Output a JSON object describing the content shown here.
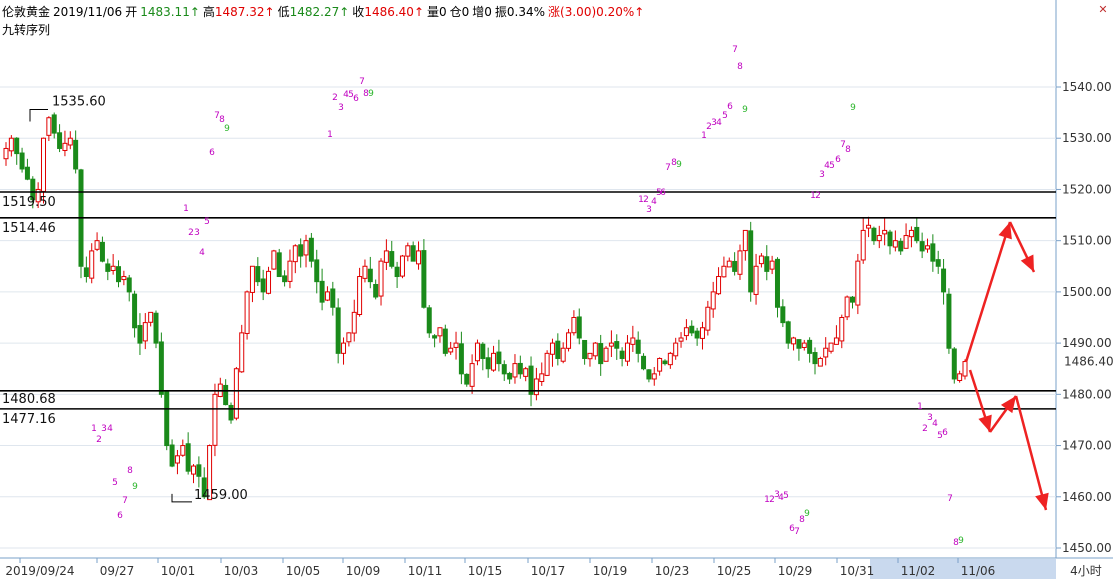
{
  "header": {
    "symbol": "伦敦黄金",
    "date": "2019/11/06",
    "open_label": "开",
    "open": "1483.11",
    "high_label": "高",
    "high": "1487.32",
    "low_label": "低",
    "low": "1482.27",
    "close_label": "收",
    "close": "1486.40",
    "volume": "量0",
    "position": "仓0",
    "increase": "增0",
    "amplitude": "振0.34%",
    "change": "涨(3.00)0.20%",
    "arrow": "↑"
  },
  "indicator_label": "九转序列",
  "period_label": "4小时",
  "colors": {
    "up": "#e00000",
    "down": "#1a8a1a",
    "td_buy": "#c000c0",
    "td_sell": "#2bb52b",
    "axis": "#7aa0c8"
  },
  "chart_data": {
    "type": "candlestick",
    "ylim": [
      1448,
      1552
    ],
    "yticks": [
      "1540.00",
      "1530.00",
      "1520.00",
      "1510.00",
      "1500.00",
      "1490.00",
      "1480.00",
      "1470.00",
      "1460.00",
      "1450.00"
    ],
    "xticks": [
      "2019/09/24",
      "09/27",
      "10/01",
      "10/03",
      "10/05",
      "10/09",
      "10/11",
      "10/15",
      "10/17",
      "10/19",
      "10/23",
      "10/25",
      "10/29",
      "10/31",
      "11/02",
      "11/06"
    ],
    "current_price": "1486.40",
    "levels": [
      {
        "label": "1535.60",
        "value": 1535.6
      },
      {
        "label": "1519.50",
        "value": 1519.5
      },
      {
        "label": "1514.46",
        "value": 1514.46
      },
      {
        "label": "1480.68",
        "value": 1480.68
      },
      {
        "label": "1477.16",
        "value": 1477.16
      },
      {
        "label": "1459.00",
        "value": 1459.0
      }
    ],
    "closes": [
      1528,
      1530,
      1527,
      1524,
      1522,
      1518,
      1520,
      1530,
      1534,
      1531,
      1528,
      1529,
      1530,
      1524,
      1505,
      1503,
      1508,
      1510,
      1506,
      1504,
      1505,
      1502,
      1503,
      1500,
      1493,
      1490,
      1494,
      1496,
      1490,
      1480,
      1470,
      1466,
      1468,
      1470,
      1465,
      1466,
      1464,
      1460,
      1470,
      1480,
      1482,
      1478,
      1475,
      1485,
      1492,
      1500,
      1505,
      1502,
      1500,
      1504,
      1508,
      1503,
      1502,
      1506,
      1509,
      1507,
      1510,
      1506,
      1502,
      1498,
      1500,
      1497,
      1488,
      1490,
      1492,
      1496,
      1503,
      1505,
      1502,
      1499,
      1506,
      1508,
      1505,
      1503,
      1507,
      1509,
      1506,
      1508,
      1497,
      1492,
      1491,
      1493,
      1488,
      1489,
      1490,
      1484,
      1482,
      1486,
      1490,
      1487,
      1485,
      1488,
      1486,
      1484,
      1483,
      1486,
      1484,
      1485,
      1480,
      1483,
      1484,
      1488,
      1490,
      1487,
      1489,
      1492,
      1495,
      1491,
      1487,
      1488,
      1490,
      1486,
      1489,
      1490,
      1489,
      1487,
      1490,
      1491,
      1488,
      1485,
      1483,
      1484,
      1487,
      1486,
      1488,
      1490,
      1491,
      1493,
      1492,
      1491,
      1493,
      1497,
      1500,
      1503,
      1505,
      1506,
      1504,
      1508,
      1512,
      1500,
      1505,
      1507,
      1504,
      1506,
      1497,
      1494,
      1490,
      1491,
      1489,
      1490,
      1488,
      1486,
      1487,
      1489,
      1490,
      1491,
      1495,
      1499,
      1498,
      1506,
      1512,
      1513,
      1510,
      1511,
      1512,
      1509,
      1510,
      1508,
      1511,
      1512,
      1510,
      1508,
      1509,
      1506,
      1505,
      1500,
      1489,
      1483,
      1484,
      1486.4
    ],
    "td_buy": [
      {
        "n": "1",
        "x": 330,
        "y": 137
      },
      {
        "n": "2",
        "x": 335,
        "y": 100
      },
      {
        "n": "3",
        "x": 341,
        "y": 110
      },
      {
        "n": "4",
        "x": 346,
        "y": 97
      },
      {
        "n": "5",
        "x": 351,
        "y": 97
      },
      {
        "n": "6",
        "x": 356,
        "y": 101
      },
      {
        "n": "7",
        "x": 362,
        "y": 84
      },
      {
        "n": "8",
        "x": 366,
        "y": 96
      },
      {
        "n": "1",
        "x": 186,
        "y": 211
      },
      {
        "n": "2",
        "x": 191,
        "y": 235
      },
      {
        "n": "3",
        "x": 197,
        "y": 235
      },
      {
        "n": "4",
        "x": 202,
        "y": 255
      },
      {
        "n": "5",
        "x": 207,
        "y": 224
      },
      {
        "n": "6",
        "x": 212,
        "y": 155
      },
      {
        "n": "7",
        "x": 217,
        "y": 118
      },
      {
        "n": "8",
        "x": 222,
        "y": 122
      },
      {
        "n": "1",
        "x": 94,
        "y": 431
      },
      {
        "n": "2",
        "x": 99,
        "y": 442
      },
      {
        "n": "3",
        "x": 104,
        "y": 431
      },
      {
        "n": "4",
        "x": 110,
        "y": 431
      },
      {
        "n": "5",
        "x": 115,
        "y": 485
      },
      {
        "n": "6",
        "x": 120,
        "y": 518
      },
      {
        "n": "7",
        "x": 125,
        "y": 503
      },
      {
        "n": "8",
        "x": 130,
        "y": 473
      },
      {
        "n": "1",
        "x": 641,
        "y": 202
      },
      {
        "n": "2",
        "x": 646,
        "y": 202
      },
      {
        "n": "3",
        "x": 649,
        "y": 212
      },
      {
        "n": "4",
        "x": 654,
        "y": 204
      },
      {
        "n": "5",
        "x": 659,
        "y": 195
      },
      {
        "n": "6",
        "x": 663,
        "y": 195
      },
      {
        "n": "7",
        "x": 668,
        "y": 170
      },
      {
        "n": "8",
        "x": 674,
        "y": 165
      },
      {
        "n": "1",
        "x": 704,
        "y": 138
      },
      {
        "n": "2",
        "x": 709,
        "y": 129
      },
      {
        "n": "3",
        "x": 714,
        "y": 125
      },
      {
        "n": "4",
        "x": 719,
        "y": 125
      },
      {
        "n": "5",
        "x": 725,
        "y": 118
      },
      {
        "n": "6",
        "x": 730,
        "y": 109
      },
      {
        "n": "7",
        "x": 735,
        "y": 52
      },
      {
        "n": "8",
        "x": 740,
        "y": 69
      },
      {
        "n": "1",
        "x": 813,
        "y": 198
      },
      {
        "n": "2",
        "x": 818,
        "y": 198
      },
      {
        "n": "3",
        "x": 822,
        "y": 177
      },
      {
        "n": "4",
        "x": 827,
        "y": 168
      },
      {
        "n": "5",
        "x": 832,
        "y": 168
      },
      {
        "n": "6",
        "x": 838,
        "y": 162
      },
      {
        "n": "7",
        "x": 843,
        "y": 147
      },
      {
        "n": "8",
        "x": 848,
        "y": 152
      },
      {
        "n": "1",
        "x": 767,
        "y": 502
      },
      {
        "n": "2",
        "x": 772,
        "y": 502
      },
      {
        "n": "3",
        "x": 777,
        "y": 497
      },
      {
        "n": "4",
        "x": 781,
        "y": 500
      },
      {
        "n": "5",
        "x": 786,
        "y": 498
      },
      {
        "n": "6",
        "x": 792,
        "y": 531
      },
      {
        "n": "7",
        "x": 797,
        "y": 534
      },
      {
        "n": "8",
        "x": 802,
        "y": 522
      },
      {
        "n": "1",
        "x": 920,
        "y": 409
      },
      {
        "n": "2",
        "x": 925,
        "y": 431
      },
      {
        "n": "3",
        "x": 930,
        "y": 420
      },
      {
        "n": "4",
        "x": 935,
        "y": 426
      },
      {
        "n": "5",
        "x": 940,
        "y": 438
      },
      {
        "n": "6",
        "x": 945,
        "y": 435
      },
      {
        "n": "7",
        "x": 950,
        "y": 501
      },
      {
        "n": "8",
        "x": 956,
        "y": 545
      }
    ],
    "td_sell": [
      {
        "n": "9",
        "x": 371,
        "y": 96
      },
      {
        "n": "9",
        "x": 227,
        "y": 131
      },
      {
        "n": "9",
        "x": 135,
        "y": 489
      },
      {
        "n": "9",
        "x": 679,
        "y": 167
      },
      {
        "n": "9",
        "x": 745,
        "y": 112
      },
      {
        "n": "9",
        "x": 853,
        "y": 110
      },
      {
        "n": "9",
        "x": 807,
        "y": 516
      },
      {
        "n": "9",
        "x": 961,
        "y": 543
      }
    ]
  }
}
